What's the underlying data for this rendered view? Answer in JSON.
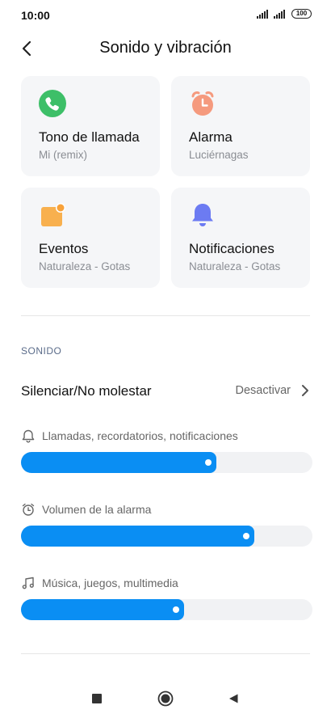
{
  "status_bar": {
    "time": "10:00",
    "battery": "100"
  },
  "header": {
    "title": "Sonido y vibración"
  },
  "cards": [
    {
      "title": "Tono de llamada",
      "subtitle": "Mi (remix)",
      "icon": "phone-icon",
      "color": "#3dbf68"
    },
    {
      "title": "Alarma",
      "subtitle": "Luciérnagas",
      "icon": "alarm-clock-icon",
      "color": "#f59a7e"
    },
    {
      "title": "Eventos",
      "subtitle": "Naturaleza - Gotas",
      "icon": "calendar-event-icon",
      "color": "#f8b04e"
    },
    {
      "title": "Notificaciones",
      "subtitle": "Naturaleza - Gotas",
      "icon": "bell-icon",
      "color": "#6c7bf2"
    }
  ],
  "sound_section": {
    "label": "SONIDO",
    "dnd": {
      "label": "Silenciar/No molestar",
      "value": "Desactivar"
    },
    "volumes": [
      {
        "label": "Llamadas, recordatorios, notificaciones",
        "icon": "bell-outline-icon",
        "level": 0.67
      },
      {
        "label": "Volumen de la alarma",
        "icon": "alarm-outline-icon",
        "level": 0.8
      },
      {
        "label": "Música, juegos, multimedia",
        "icon": "music-note-icon",
        "level": 0.56
      }
    ]
  },
  "accent_color": "#0a8ef3"
}
